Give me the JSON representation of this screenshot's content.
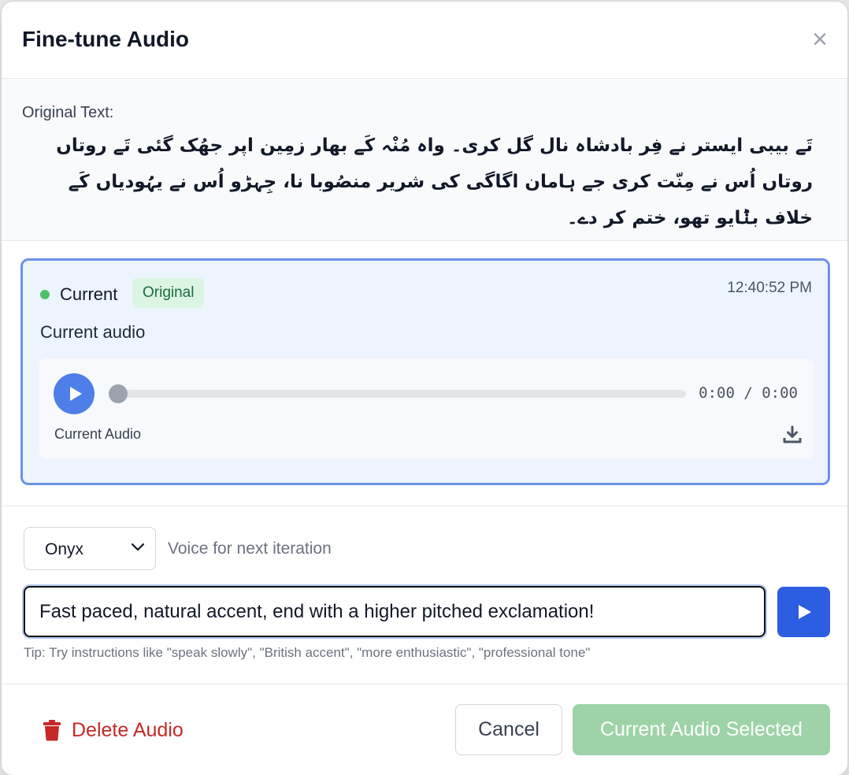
{
  "modal": {
    "title": "Fine-tune Audio",
    "close_icon": "close-icon"
  },
  "original": {
    "label": "Original Text:",
    "text": "تَے بیبی ایستر نے فِر بادشاہ نال گل کری۔ واہ مُنْہ کَے بھار زمِین اپر جھُک گئی تَے روتاں روتاں اُس نے مِنّت کری جے ہامان اگاگی کی شریر منصُوبا نا، جِہڑو اُس نے یہُودیاں کَے خلاف بݨایو تھو، ختم کر دے۔"
  },
  "current": {
    "label": "Current",
    "badge": "Original",
    "timestamp": "12:40:52 PM",
    "description": "Current audio",
    "player": {
      "time": "0:00 / 0:00",
      "progress": 0,
      "label": "Current Audio",
      "play_icon": "play-icon",
      "download_icon": "download-icon"
    }
  },
  "voice": {
    "selected": "Onyx",
    "hint": "Voice for next iteration"
  },
  "instructions": {
    "value": "Fast paced, natural accent, end with a higher pitched exclamation!",
    "tip": "Tip: Try instructions like \"speak slowly\", \"British accent\", \"more enthusiastic\", \"professional tone\""
  },
  "footer": {
    "delete_label": "Delete Audio",
    "cancel_label": "Cancel",
    "select_label": "Current Audio Selected"
  },
  "colors": {
    "accent": "#2d5de0",
    "current_border": "#6b93e8",
    "delete": "#c62828",
    "selected_button": "#9dd3a7",
    "status_dot": "#4ec266"
  }
}
